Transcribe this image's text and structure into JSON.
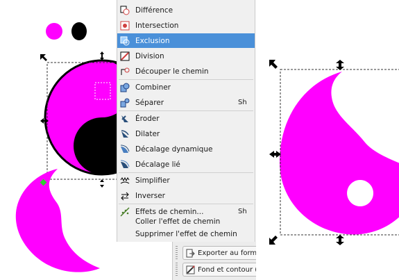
{
  "menu": {
    "items": [
      {
        "label": "Différence",
        "icon": "difference-icon",
        "shortcut": ""
      },
      {
        "label": "Intersection",
        "icon": "intersection-icon",
        "shortcut": ""
      },
      {
        "label": "Exclusion",
        "icon": "exclusion-icon",
        "shortcut": "",
        "selected": true
      },
      {
        "label": "Division",
        "icon": "division-icon",
        "shortcut": ""
      },
      {
        "label": "Découper le chemin",
        "icon": "cut-path-icon",
        "shortcut": ""
      },
      {
        "label": "Combiner",
        "icon": "combine-icon",
        "shortcut": ""
      },
      {
        "label": "Séparer",
        "icon": "break-apart-icon",
        "shortcut": "Sh"
      },
      {
        "label": "Éroder",
        "icon": "inset-icon",
        "shortcut": ""
      },
      {
        "label": "Dilater",
        "icon": "outset-icon",
        "shortcut": ""
      },
      {
        "label": "Décalage dynamique",
        "icon": "dynamic-offset-icon",
        "shortcut": ""
      },
      {
        "label": "Décalage lié",
        "icon": "linked-offset-icon",
        "shortcut": ""
      },
      {
        "label": "Simplifier",
        "icon": "simplify-icon",
        "shortcut": ""
      },
      {
        "label": "Inverser",
        "icon": "reverse-icon",
        "shortcut": ""
      },
      {
        "label": "Effets de chemin...",
        "icon": "path-effects-icon",
        "shortcut": "Sh"
      },
      {
        "label": "Coller l'effet de chemin",
        "icon": "",
        "shortcut": ""
      },
      {
        "label": "Supprimer l'effet de chemin",
        "icon": "",
        "shortcut": ""
      }
    ],
    "selected_color": "#4a90d9"
  },
  "dock": {
    "export_label": "Exporter au form",
    "fill_stroke_label": "Fond et contour ("
  },
  "colors": {
    "magenta": "#ff00ff",
    "black": "#000000",
    "selection_handle": "#000000",
    "node_green": "#33cc33"
  }
}
